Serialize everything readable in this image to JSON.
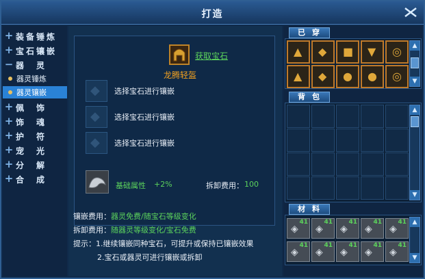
{
  "window": {
    "title": "打造"
  },
  "nav": {
    "items": [
      {
        "label": "装备锤炼",
        "sign": "+"
      },
      {
        "label": "宝石镶嵌",
        "sign": "+"
      },
      {
        "label": "器　灵",
        "sign": "−"
      }
    ],
    "subitems": [
      {
        "label": "器灵锤炼",
        "active": false
      },
      {
        "label": "器灵镶嵌",
        "active": true
      }
    ],
    "items2": [
      {
        "label": "佩　饰",
        "sign": "+"
      },
      {
        "label": "饰　魂",
        "sign": "+"
      },
      {
        "label": "护　符",
        "sign": "+"
      },
      {
        "label": "宠　光",
        "sign": "+"
      },
      {
        "label": "分　解",
        "sign": "+"
      },
      {
        "label": "合　成",
        "sign": "+"
      }
    ]
  },
  "forge": {
    "get_gem_link": "获取宝石",
    "item_name": "龙腾轻盔",
    "gem_slot_text": "选择宝石进行镶嵌",
    "base_attr_label": "基础属性",
    "base_attr_value": "+2%",
    "remove_fee_label": "拆卸费用：",
    "remove_fee_value": "100"
  },
  "info": {
    "inlay_fee_key": "镶嵌费用：",
    "inlay_fee_val": "器灵免费/随宝石等级变化",
    "remove_fee_key": "拆卸费用：",
    "remove_fee_val": "随器灵等级变化/宝石免费",
    "tip_key": "提示：",
    "tip1": "1.继续镶嵌同种宝石，可提升或保持已镶嵌效果",
    "tip2": "2.宝石或器灵可进行镶嵌或拆卸"
  },
  "right": {
    "equipped_tab": "已穿",
    "bag_tab": "背包",
    "materials_tab": "材料",
    "material_count": "41"
  },
  "colors": {
    "accent": "#2a82d6",
    "green": "#5cd35c",
    "orange": "#f0a020"
  }
}
